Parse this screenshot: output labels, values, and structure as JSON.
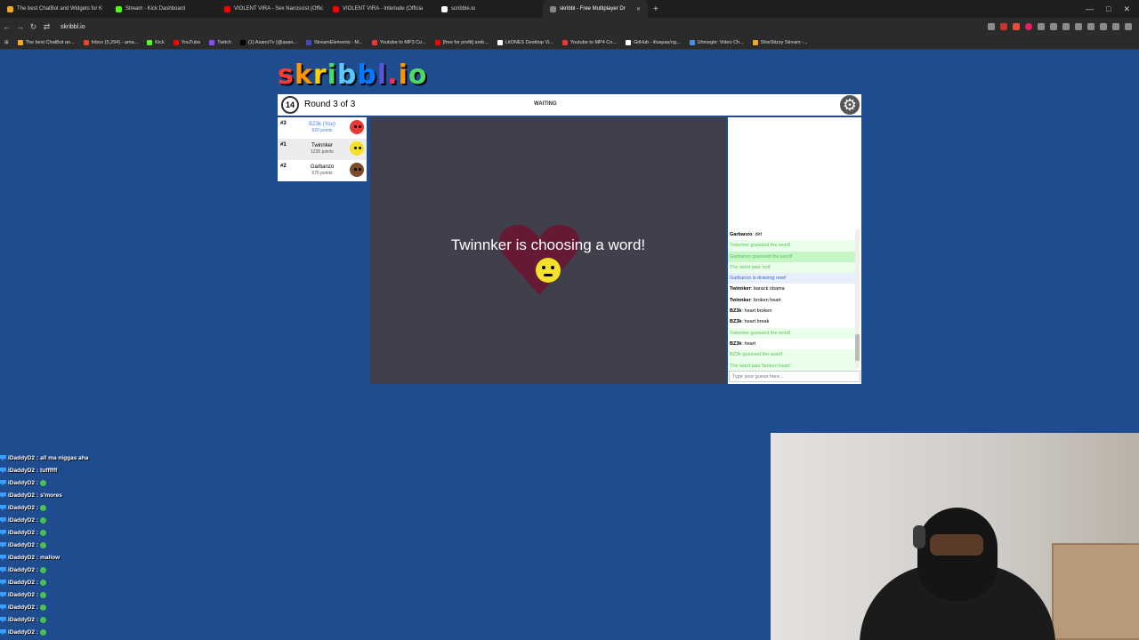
{
  "browser": {
    "tabs": [
      {
        "title": "The best ChatBot and Widgets for K",
        "color": "#f5a623",
        "active": false
      },
      {
        "title": "Stream - Kick Dashboard",
        "color": "#53fc18",
        "active": false
      },
      {
        "title": "VIOLENT VIRA - Sex Narcissist (Offic",
        "color": "#ff0000",
        "active": false
      },
      {
        "title": "VIOLENT VIRA - Interlude (Officia",
        "color": "#ff0000",
        "active": false
      },
      {
        "title": "scribble.io",
        "color": "#ffffff",
        "active": false
      },
      {
        "title": "skribbl - Free Multiplayer Dr",
        "color": "#888888",
        "active": true
      }
    ],
    "url": "skribbl.io",
    "bookmarks": [
      {
        "label": "The best ChatBot an...",
        "color": "#f5a623"
      },
      {
        "label": "Inbox (5,294) - ama...",
        "color": "#ea4335"
      },
      {
        "label": "Kick",
        "color": "#53fc18"
      },
      {
        "label": "YouTube",
        "color": "#ff0000"
      },
      {
        "label": "Twitch",
        "color": "#9146ff"
      },
      {
        "label": "(1) AsanoTv (@asan...",
        "color": "#000000"
      },
      {
        "label": "StreamElements - M...",
        "color": "#3b4cc0"
      },
      {
        "label": "Youtube to MP3 Co...",
        "color": "#e53935"
      },
      {
        "label": "[free for profit] amb...",
        "color": "#ff0000"
      },
      {
        "label": "LitONES Desktop Vi...",
        "color": "#ffffff"
      },
      {
        "label": "Youtube to MP4 Co...",
        "color": "#e53935"
      },
      {
        "label": "GitHub - illuspas/ng...",
        "color": "#ffffff"
      },
      {
        "label": "Uhmegle: Video Ch...",
        "color": "#4a90e2"
      },
      {
        "label": "ShieStizzy Stream -...",
        "color": "#f5a623"
      }
    ]
  },
  "game": {
    "logo": "skribbl.io",
    "logo_colors": [
      "#ff3b30",
      "#ff9500",
      "#ffcc00",
      "#4cd964",
      "#5ac8fa",
      "#007aff",
      "#5856d6",
      "#ff2d55",
      "#ff9500",
      "#4cd964"
    ],
    "timer": "14",
    "round": "Round 3 of 3",
    "status": "WAITING",
    "players": [
      {
        "rank": "#3",
        "name": "BZ3k (You)",
        "points": "620 points",
        "avatar_color": "#e53935",
        "me": true
      },
      {
        "rank": "#1",
        "name": "Twinnker",
        "points": "1235 points",
        "avatar_color": "#f5e02a",
        "me": false
      },
      {
        "rank": "#2",
        "name": "Garbanzo",
        "points": "675 points",
        "avatar_color": "#7a4a2a",
        "me": false
      }
    ],
    "canvas_message": "Twinnker is choosing a word!",
    "chat": [
      {
        "name": "Garbanzo",
        "text": "dirt",
        "type": "normal"
      },
      {
        "name": "",
        "text": "Twinnker guessed the word!",
        "type": "green"
      },
      {
        "name": "",
        "text": "Garbanzo guessed the word!",
        "type": "green2"
      },
      {
        "name": "",
        "text": "The word was 'soil'",
        "type": "green"
      },
      {
        "name": "",
        "text": "Garbanzo is drawing now!",
        "type": "blue"
      },
      {
        "name": "Twinnker",
        "text": "barack obama",
        "type": "normal"
      },
      {
        "name": "Twinnker",
        "text": "broken heart",
        "type": "normal"
      },
      {
        "name": "BZ3k",
        "text": "heart broken",
        "type": "normal"
      },
      {
        "name": "BZ3k",
        "text": "heart break",
        "type": "normal"
      },
      {
        "name": "",
        "text": "Twinnker guessed the word!",
        "type": "green"
      },
      {
        "name": "BZ3k",
        "text": "heart",
        "type": "normal"
      },
      {
        "name": "",
        "text": "BZ3k guessed the word!",
        "type": "green"
      },
      {
        "name": "",
        "text": "The word was 'broken heart'",
        "type": "green"
      }
    ],
    "guess_placeholder": "Type your guess here..."
  },
  "stream_chat": [
    {
      "user": "iDaddyD2",
      "text": "all ma niggas aha",
      "emote": false
    },
    {
      "user": "iDaddyD2",
      "text": "tuffffff",
      "emote": false
    },
    {
      "user": "iDaddyD2",
      "text": "",
      "emote": true
    },
    {
      "user": "iDaddyD2",
      "text": "s'mores",
      "emote": false
    },
    {
      "user": "iDaddyD2",
      "text": "",
      "emote": true
    },
    {
      "user": "iDaddyD2",
      "text": "",
      "emote": true
    },
    {
      "user": "iDaddyD2",
      "text": "",
      "emote": true
    },
    {
      "user": "iDaddyD2",
      "text": "",
      "emote": true
    },
    {
      "user": "iDaddyD2",
      "text": "mallow",
      "emote": false
    },
    {
      "user": "iDaddyD2",
      "text": "",
      "emote": true
    },
    {
      "user": "iDaddyD2",
      "text": "",
      "emote": true
    },
    {
      "user": "iDaddyD2",
      "text": "",
      "emote": true
    },
    {
      "user": "iDaddyD2",
      "text": "",
      "emote": true
    },
    {
      "user": "iDaddyD2",
      "text": "",
      "emote": true
    },
    {
      "user": "iDaddyD2",
      "text": "",
      "emote": true
    }
  ]
}
